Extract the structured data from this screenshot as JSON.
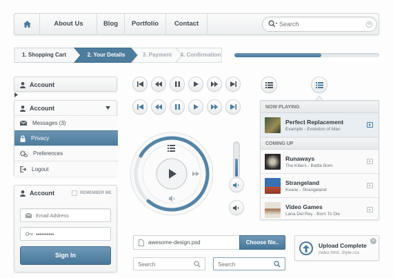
{
  "nav": {
    "items": [
      "About Us",
      "Blog",
      "Portfolio",
      "Contact"
    ],
    "search_placeholder": "Search"
  },
  "steps": [
    {
      "label": "1. Shopping Cart",
      "state": "done"
    },
    {
      "label": "2. Your Details",
      "state": "current"
    },
    {
      "label": "3. Payment",
      "state": "todo"
    },
    {
      "label": "4. Confirmation",
      "state": "todo"
    }
  ],
  "progress": {
    "value": 0.6
  },
  "account_collapsed": {
    "label": "Account"
  },
  "account_menu": {
    "label": "Account",
    "items": [
      {
        "label": "Messages (3)",
        "icon": "mail-icon"
      },
      {
        "label": "Privacy",
        "icon": "lock-icon",
        "active": true
      },
      {
        "label": "Preferences",
        "icon": "gear-icon"
      },
      {
        "label": "Logout",
        "icon": "logout-icon"
      }
    ]
  },
  "login": {
    "label": "Account",
    "remember": "REMEMBER ME",
    "email_placeholder": "Email Address",
    "password_value": "••••••••••",
    "sign_in": "Sign In"
  },
  "player": {
    "progress": 0.78,
    "volume": 0.55
  },
  "playlist": {
    "now_playing_header": "NOW PLAYING",
    "coming_up_header": "COMING UP",
    "now_playing": {
      "title": "Perfect Replacement",
      "subtitle": "Example - Evolution of Man"
    },
    "coming_up": [
      {
        "title": "Runaways",
        "subtitle": "The Killers - Battle Born"
      },
      {
        "title": "Strangeland",
        "subtitle": "Keane - Strangeland"
      },
      {
        "title": "Video Games",
        "subtitle": "Lana Del Rey - Born To Die"
      }
    ]
  },
  "file_input": {
    "filename": "awesome-design.psd",
    "button": "Choose file.."
  },
  "search_boxes": [
    {
      "placeholder": "Search"
    },
    {
      "placeholder": "Search"
    }
  ],
  "upload": {
    "title": "Upload Complete",
    "files": "index.html, Style.css"
  },
  "colors": {
    "accent": "#4a7a9c",
    "panel": "#f2f3f4"
  }
}
